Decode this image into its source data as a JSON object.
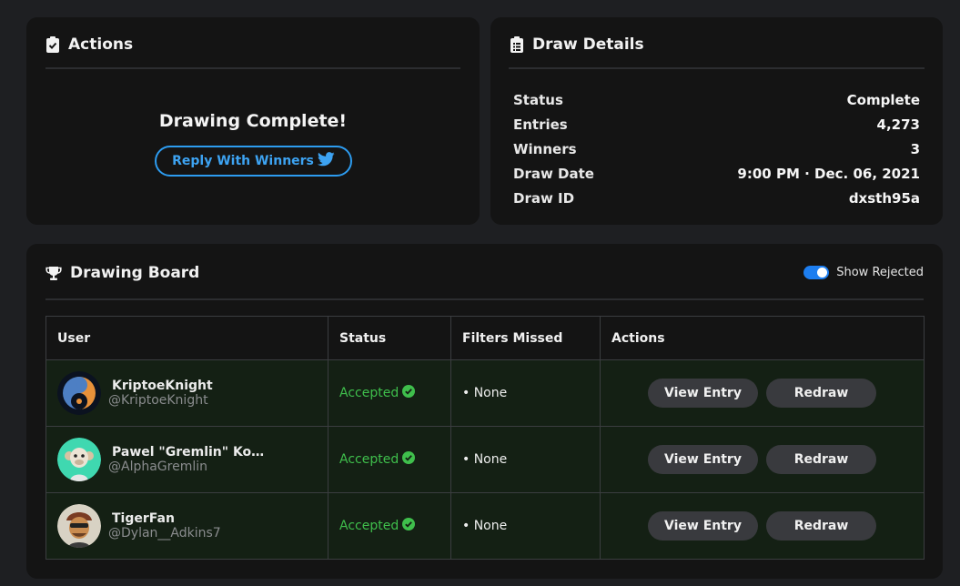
{
  "actions": {
    "title": "Actions",
    "complete_text": "Drawing Complete!",
    "reply_button": "Reply With Winners"
  },
  "details": {
    "title": "Draw Details",
    "rows": [
      {
        "label": "Status",
        "value": "Complete"
      },
      {
        "label": "Entries",
        "value": "4,273"
      },
      {
        "label": "Winners",
        "value": "3"
      },
      {
        "label": "Draw Date",
        "value": "9:00 PM · Dec. 06, 2021"
      },
      {
        "label": "Draw ID",
        "value": "dxsth95a"
      }
    ]
  },
  "board": {
    "title": "Drawing Board",
    "toggle_label": "Show Rejected",
    "toggle_on": true,
    "columns": [
      "User",
      "Status",
      "Filters Missed",
      "Actions"
    ],
    "rows": [
      {
        "name": "KriptoeKnight",
        "handle": "@KriptoeKnight",
        "status": "Accepted",
        "filters": "• None",
        "view": "View Entry",
        "redraw": "Redraw"
      },
      {
        "name": "Pawel \"Gremlin\" Kozl...",
        "handle": "@AlphaGremlin",
        "status": "Accepted",
        "filters": "• None",
        "view": "View Entry",
        "redraw": "Redraw"
      },
      {
        "name": "TigerFan",
        "handle": "@Dylan__Adkins7",
        "status": "Accepted",
        "filters": "• None",
        "view": "View Entry",
        "redraw": "Redraw"
      }
    ]
  },
  "colors": {
    "accent_blue": "#2d9cf0",
    "accepted_green": "#3fbf4c",
    "card_bg": "#141414",
    "page_bg": "#1e1f22",
    "row_bg": "#142014"
  },
  "icons": [
    "clipboard-check-icon",
    "clipboard-list-icon",
    "trophy-icon",
    "twitter-bird-icon",
    "check-circle-icon"
  ]
}
